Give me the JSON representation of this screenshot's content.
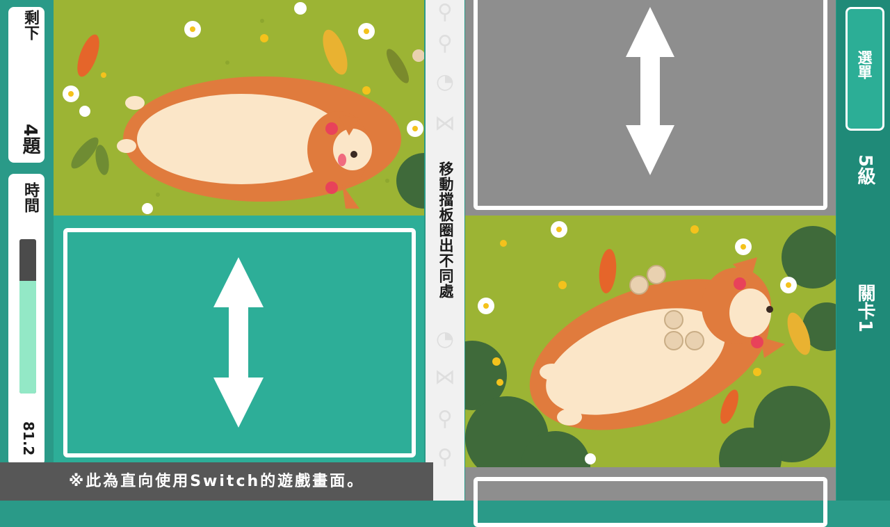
{
  "hud": {
    "remaining_label": "剩下",
    "remaining_count": "4題",
    "time_label": "時間",
    "time_value": "81.2",
    "time_fraction": 0.73
  },
  "instruction": "移動擋板圈出不同處",
  "menu_label": "選單",
  "level": "5級",
  "stage": "關卡1",
  "caption": "※此為直向使用Switch的遊戲畫面。",
  "colors": {
    "panel_teal": "#2a9a88",
    "shutter_teal": "#2dae98",
    "shutter_gray": "#8e8e8e",
    "grass": "#9cb434",
    "time_fill": "#93e8c6"
  }
}
